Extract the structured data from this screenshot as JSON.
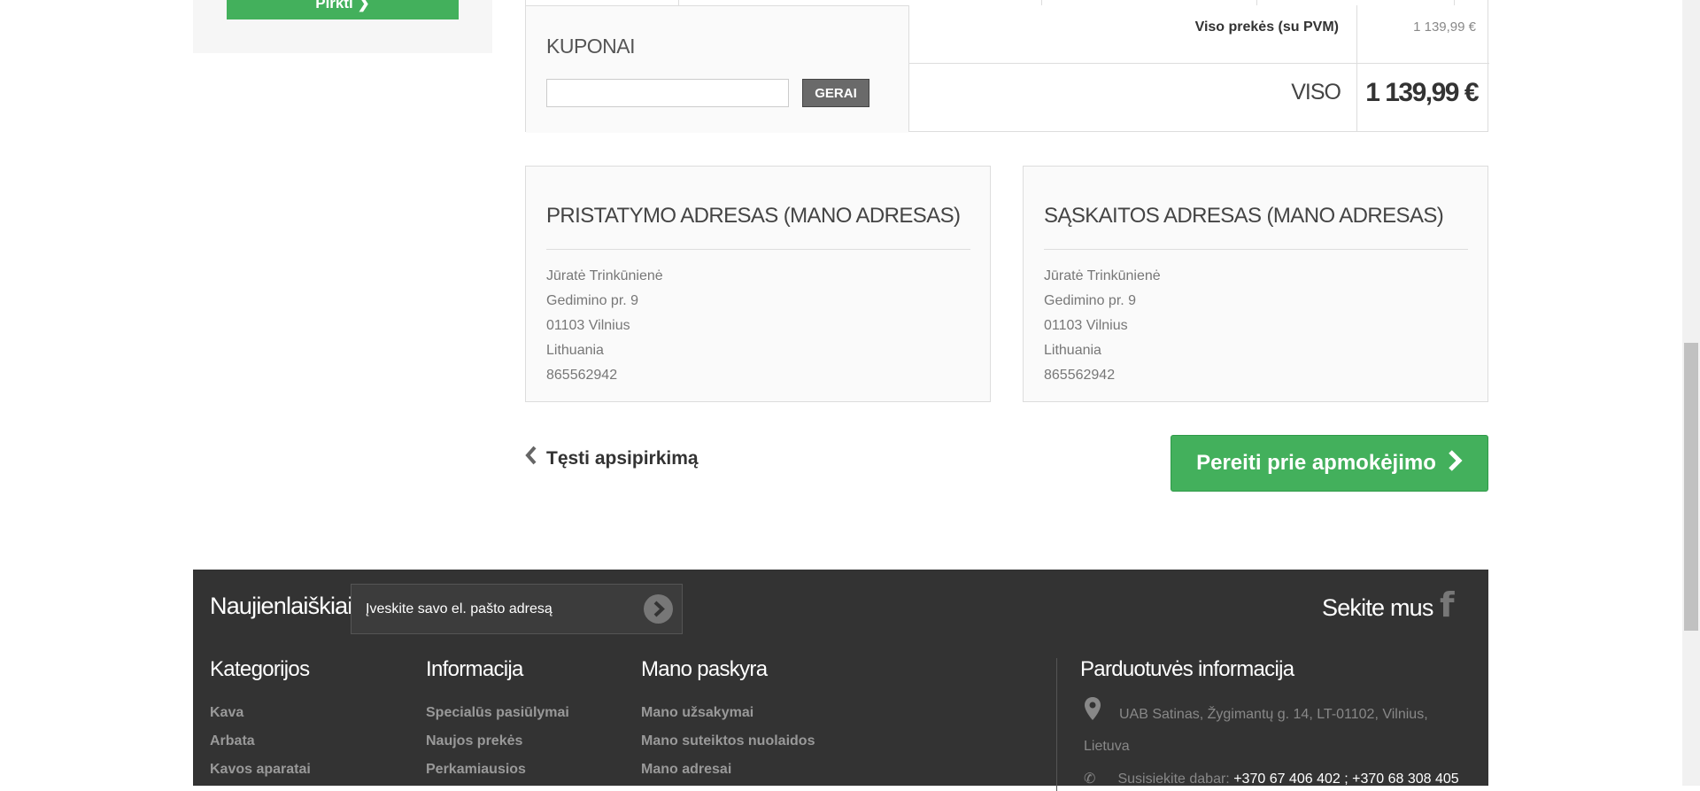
{
  "sidebar": {
    "buy_button": "Pirkti ❯"
  },
  "cart_summary": {
    "coupon_title": "KUPONAI",
    "coupon_input_value": "",
    "coupon_button": "GERAI",
    "subtotal_label": "Viso prekės (su PVM)",
    "subtotal_value": "1 139,99 €",
    "total_label": "VISO",
    "total_value": "1 139,99 €"
  },
  "delivery_address": {
    "title": "PRISTATYMO ADRESAS (MANO ADRESAS)",
    "lines": [
      "Jūratė Trinkūnienė",
      "Gedimino pr. 9",
      "01103 Vilnius",
      "Lithuania",
      "865562942"
    ]
  },
  "billing_address": {
    "title": "SĄSKAITOS ADRESAS (MANO ADRESAS)",
    "lines": [
      "Jūratė Trinkūnienė",
      "Gedimino pr. 9",
      "01103 Vilnius",
      "Lithuania",
      "865562942"
    ]
  },
  "actions": {
    "continue_shopping": "Tęsti apsipirkimą",
    "checkout": "Pereiti prie apmokėjimo"
  },
  "footer": {
    "newsletter_title": "Naujienlaiškiai",
    "newsletter_placeholder": "Įveskite savo el. pašto adresą",
    "follow_us": "Sekite mus",
    "categories": {
      "title": "Kategorijos",
      "links": [
        "Kava",
        "Arbata",
        "Kavos aparatai"
      ]
    },
    "information": {
      "title": "Informacija",
      "links": [
        "Specialūs pasiūlymai",
        "Naujos prekės",
        "Perkamiausios"
      ]
    },
    "account": {
      "title": "Mano paskyra",
      "links": [
        "Mano užsakymai",
        "Mano suteiktos nuolaidos",
        "Mano adresai"
      ]
    },
    "store_info": {
      "title": "Parduotuvės informacija",
      "address": "UAB Satinas, Žygimantų g. 14, LT-01102, Vilnius, Lietuva",
      "phone_label": "Susisiekite dabar:",
      "phones": "+370 67 406 402 ; +370 68 308 405"
    }
  },
  "colors": {
    "accent_green": "#43b05c",
    "footer_bg": "#333333"
  }
}
